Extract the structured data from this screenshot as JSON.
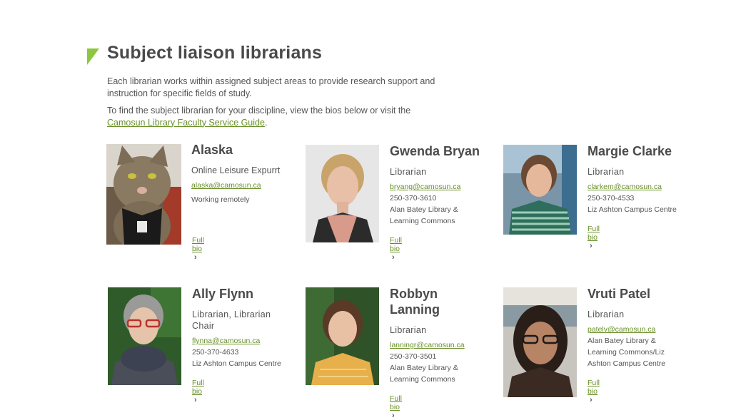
{
  "heading": "Subject liaison librarians",
  "intro": {
    "line1": "Each librarian works within assigned subject areas to provide research support and instruction for specific fields of study.",
    "line2_prefix": "To find the subject librarian for your discipline, view the bios below or visit the",
    "link_text": "Camosun Library Faculty Service Guide",
    "line2_suffix": "."
  },
  "librarians": [
    {
      "name": "Alaska",
      "role": "Online Leisure Expurrt",
      "email": "alaska@camosun.ca",
      "phone": "",
      "location": "Working remotely",
      "bio": "Full bio"
    },
    {
      "name": "Gwenda Bryan",
      "role": "Librarian",
      "email": "bryang@camosun.ca",
      "phone": "250-370-3610",
      "location": "Alan Batey Library & Learning Commons",
      "bio": "Full bio"
    },
    {
      "name": "Margie Clarke",
      "role": "Librarian",
      "email": "clarkem@camosun.ca",
      "phone": "250-370-4533",
      "location": "Liz Ashton Campus Centre",
      "bio": "Full bio"
    },
    {
      "name": "Ally Flynn",
      "role": "Librarian, Librarian Chair",
      "email": "flynna@camosun.ca",
      "phone": "250-370-4633",
      "location": "Liz Ashton Campus Centre",
      "bio": "Full bio"
    },
    {
      "name": "Robbyn Lanning",
      "role": "Librarian",
      "email": "lanningr@camosun.ca",
      "phone": "250-370-3501",
      "location": "Alan Batey Library & Learning Commons",
      "bio": "Full bio"
    },
    {
      "name": "Vruti Patel",
      "role": "Librarian",
      "email": "patelv@camosun.ca",
      "phone": "",
      "location": "Alan Batey Library & Learning Commons/Liz Ashton Campus Centre",
      "bio": "Full bio"
    }
  ],
  "colors": {
    "accent": "#8dc63f",
    "link": "#6a8f2a",
    "heading": "#4a4a4a"
  },
  "icons": {
    "bio_link": "chevron-right-icon"
  }
}
